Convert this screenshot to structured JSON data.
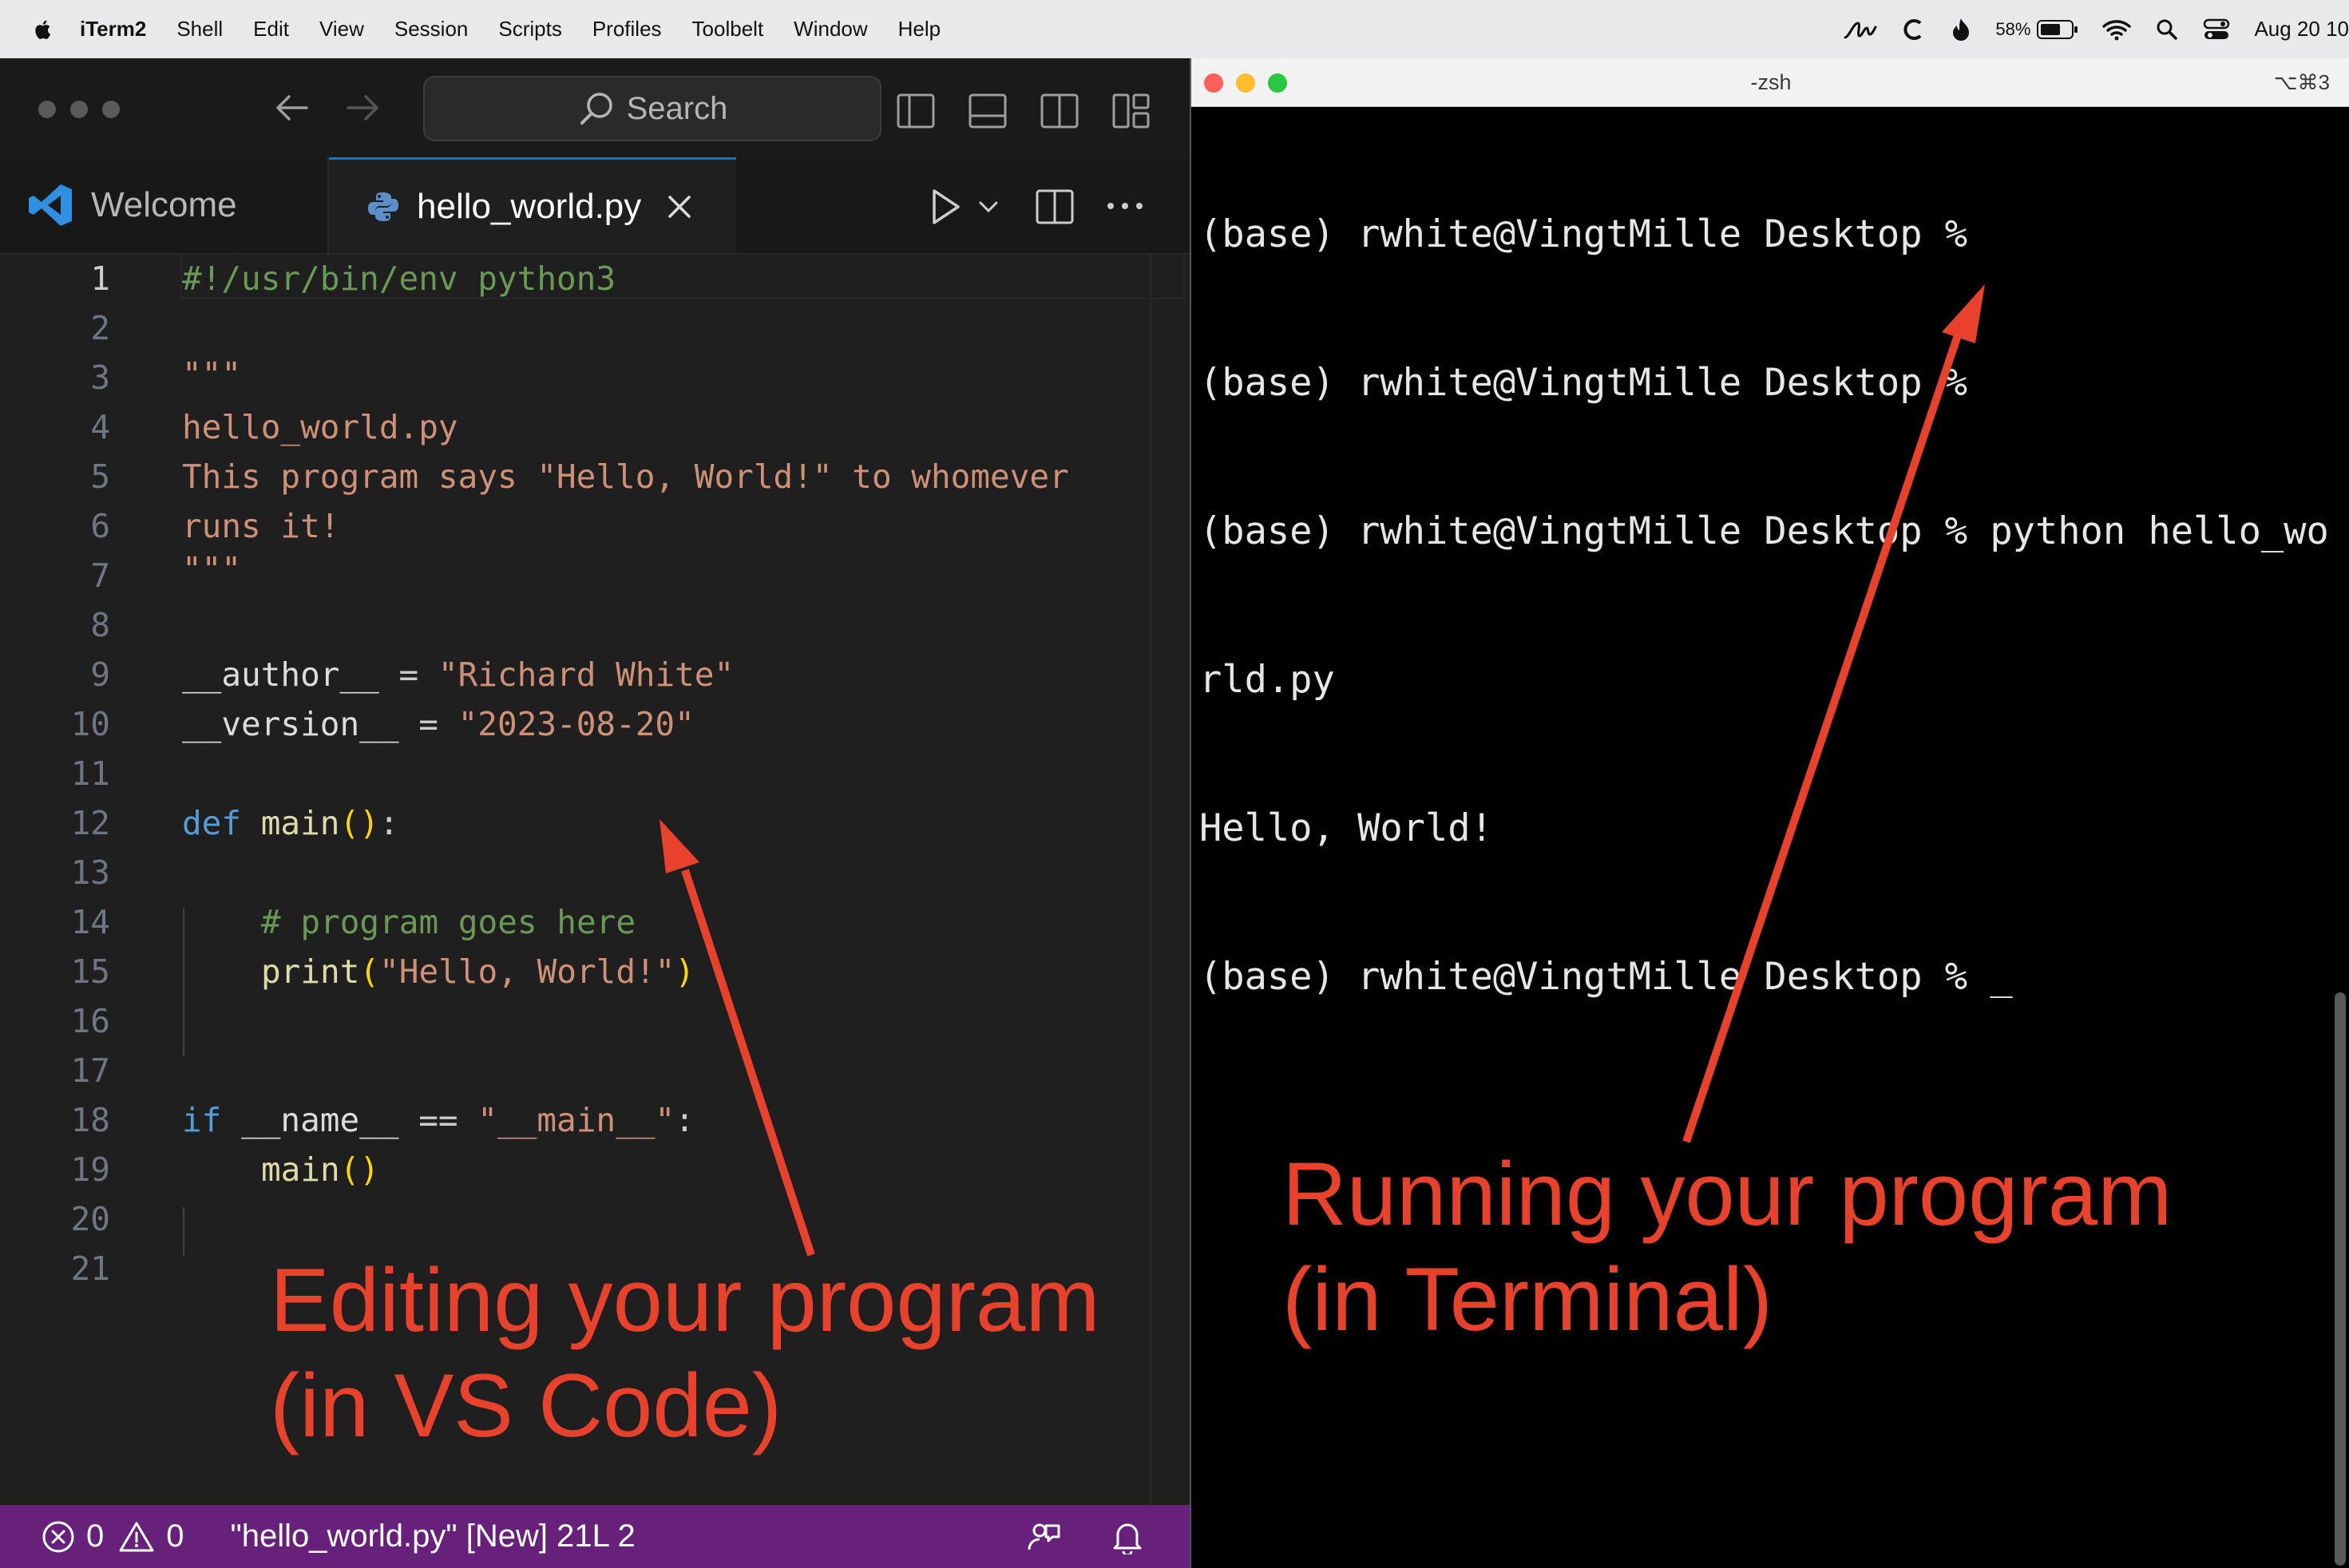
{
  "menubar": {
    "items": [
      "iTerm2",
      "Shell",
      "Edit",
      "View",
      "Session",
      "Scripts",
      "Profiles",
      "Toolbelt",
      "Window",
      "Help"
    ],
    "battery": "58%",
    "date": "Aug 20 10"
  },
  "vscode": {
    "search_placeholder": "Search",
    "tabs": [
      {
        "label": "Welcome"
      },
      {
        "label": "hello_world.py"
      }
    ],
    "line_numbers": [
      "1",
      "2",
      "3",
      "4",
      "5",
      "6",
      "7",
      "8",
      "9",
      "10",
      "11",
      "12",
      "13",
      "14",
      "15",
      "16",
      "17",
      "18",
      "19",
      "20",
      "21"
    ],
    "code": {
      "l1": "#!/usr/bin/env python3",
      "l3": "\"\"\"",
      "l4": "hello_world.py",
      "l5": "This program says \"Hello, World!\" to whomever",
      "l6": "runs it!",
      "l7": "\"\"\"",
      "l9_name": "__author__",
      "l9_op": " = ",
      "l9_val": "\"Richard White\"",
      "l10_name": "__version__",
      "l10_op": " = ",
      "l10_val": "\"2023-08-20\"",
      "l12_kw": "def",
      "l12_fn": "main",
      "l12_paren": "()",
      "l12_end": ":",
      "l14": "# program goes here",
      "l15_fn": "print",
      "l15_open": "(",
      "l15_str": "\"Hello, World!\"",
      "l15_close": ")",
      "l18_kw": "if",
      "l18_name": "__name__",
      "l18_op": " == ",
      "l18_str": "\"__main__\"",
      "l18_end": ":",
      "l19_fn": "main",
      "l19_paren": "()"
    },
    "status": {
      "errors": "0",
      "warnings": "0",
      "message": "\"hello_world.py\" [New] 21L 2"
    }
  },
  "terminal": {
    "title": "-zsh",
    "shortcut": "⌥⌘3",
    "lines": [
      "(base) rwhite@VingtMille Desktop %",
      "(base) rwhite@VingtMille Desktop %",
      "(base) rwhite@VingtMille Desktop % python hello_wo",
      "rld.py",
      "Hello, World!",
      "(base) rwhite@VingtMille Desktop % _"
    ]
  },
  "annotations": {
    "left_line1": "Editing your program",
    "left_line2": "(in VS Code)",
    "right_line1": "Running your program",
    "right_line2": "(in Terminal)",
    "arrow_color": "#e8412c"
  },
  "colors": {
    "statusbar": "#68217a",
    "vscode_accent": "#0078d4"
  }
}
